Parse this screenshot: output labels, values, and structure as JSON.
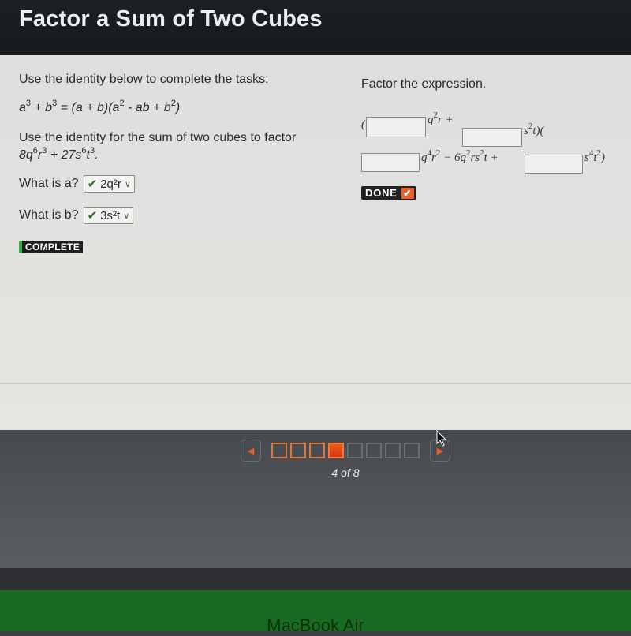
{
  "header": {
    "title": "Factor a Sum of Two Cubes"
  },
  "left": {
    "instruction": "Use the identity below to complete the tasks:",
    "identity": {
      "lhs_a": "a",
      "lhs_a_exp": "3",
      "plus1": " + ",
      "lhs_b": "b",
      "lhs_b_exp": "3",
      "equals": " = (a + b)(a",
      "a2_exp": "2",
      "mid": " - ab + b",
      "b2_exp": "2",
      "close": ")"
    },
    "task_text": "Use the identity for the sum of two cubes to factor",
    "expression": {
      "c1": "8q",
      "e1": "6",
      "v1": "r",
      "e2": "3",
      "plus": " + 27s",
      "e3": "6",
      "v2": "t",
      "e4": "3",
      "end": "."
    },
    "question_a": {
      "label": "What is a?",
      "selected": "2q²r",
      "status": "correct"
    },
    "question_b": {
      "label": "What is b?",
      "selected": "3s²t",
      "status": "correct"
    },
    "complete_badge": "COMPLETE"
  },
  "right": {
    "instruction": "Factor the expression.",
    "line1": {
      "open": "(",
      "box1_value": "",
      "term1": "q",
      "term1_exp": "2",
      "term1_rest": "r +",
      "box2_value": "",
      "term2": "s",
      "term2_exp": "2",
      "term2_rest": "t)("
    },
    "line2": {
      "box3_value": "",
      "t1": "q",
      "t1_exp": "4",
      "t1_v": "r",
      "t1_v_exp": "2",
      "mid": " − 6q",
      "mid_exp1": "2",
      "mid_v": "rs",
      "mid_exp2": "2",
      "mid_tail": "t +",
      "box4_value": "",
      "t3": "s",
      "t3_exp": "4",
      "t3_v": "t",
      "t3_v_exp": "2",
      "close": ")"
    },
    "done_button": "DONE"
  },
  "navigation": {
    "prev_icon": "◀",
    "next_icon": "▶",
    "current_page": 4,
    "total_pages": 8,
    "page_states": [
      "done",
      "done",
      "done",
      "current",
      "todo",
      "todo",
      "todo",
      "todo"
    ],
    "page_count_text": "4 of 8"
  },
  "device": {
    "label": "MacBook Air"
  },
  "colors": {
    "accent_orange": "#e8602a",
    "complete_green": "#2bb34a",
    "title_bg": "#1b2024"
  }
}
